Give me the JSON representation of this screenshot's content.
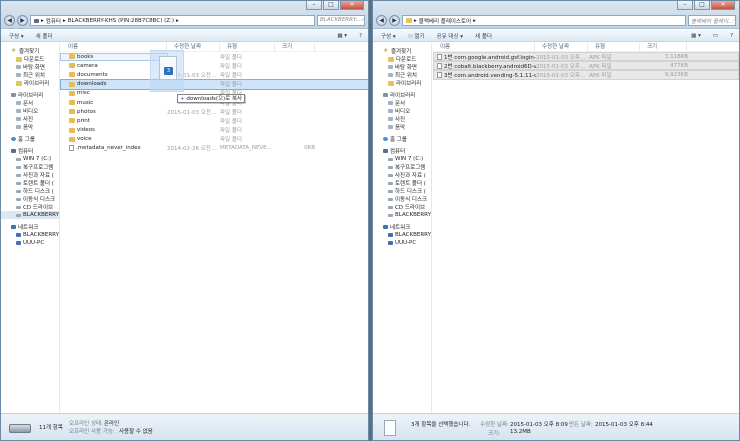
{
  "left": {
    "breadcrumb": [
      "컴퓨터",
      "BLACKBERRY-KHS (PIN:28B7C8BC) (Z:)"
    ],
    "search_placeholder": "BLACKBERRY...",
    "toolbar": {
      "organize": "구성 ▾",
      "new_folder": "새 폴더"
    },
    "columns": {
      "name": "이름",
      "date": "수정한 날짜",
      "type": "유형",
      "size": "크기"
    },
    "rows": [
      {
        "name": "books",
        "date": "",
        "type": "파일 폴더",
        "size": ""
      },
      {
        "name": "camera",
        "date": "",
        "type": "파일 폴더",
        "size": ""
      },
      {
        "name": "documents",
        "date": "2015-01-03 오전...",
        "type": "파일 폴더",
        "size": ""
      },
      {
        "name": "downloads",
        "date": "",
        "type": "파일 폴더",
        "size": ""
      },
      {
        "name": "misc",
        "date": "",
        "type": "파일 폴더",
        "size": ""
      },
      {
        "name": "music",
        "date": "",
        "type": "파일 폴더",
        "size": ""
      },
      {
        "name": "photos",
        "date": "2015-01-03 오전...",
        "type": "파일 폴더",
        "size": ""
      },
      {
        "name": "print",
        "date": "",
        "type": "파일 폴더",
        "size": ""
      },
      {
        "name": "videos",
        "date": "",
        "type": "파일 폴더",
        "size": ""
      },
      {
        "name": "voice",
        "date": "",
        "type": "파일 폴더",
        "size": ""
      },
      {
        "name": ".metadata_never_index",
        "date": "2014-02-26 오전...",
        "type": "METADATA_NEVE...",
        "size": "0KB"
      }
    ],
    "drag_tooltip": "downloads(으)로 복사",
    "status": {
      "count": "11개 항목",
      "offline_status_label": "오프라인 상태:",
      "offline_status": "온라인",
      "offline_avail_label": "오프라인 사용 가능:",
      "offline_avail": "사용할 수 없음"
    }
  },
  "right": {
    "breadcrumb": [
      "블랙베리 플레이스토어"
    ],
    "search_placeholder": "블랙베리 플레이...",
    "toolbar": {
      "organize": "구성 ▾",
      "open": "열기",
      "share": "공유 대상 ▾",
      "new_folder": "새 폴더"
    },
    "columns": {
      "name": "이름",
      "date": "수정한 날짜",
      "type": "유형",
      "size": "크기"
    },
    "rows": [
      {
        "name": "1번 com.google.android.gsf.login-4.3-c...",
        "date": "2015-01-03 오후...",
        "type": "APK 파일",
        "size": "3,118KB"
      },
      {
        "name": "2번 cobalt.blackberry.android6D-v1.3.apk",
        "date": "2015-01-03 오후...",
        "type": "APK 파일",
        "size": "477KB"
      },
      {
        "name": "3번 com.android.vending-5.1.11-cobalt...",
        "date": "2015-01-03 오후...",
        "type": "APK 파일",
        "size": "9,923KB"
      }
    ],
    "status": {
      "selected": "3개 항목을 선택했습니다.",
      "modified_label": "수정한 날짜:",
      "modified": "2015-01-03 오후 8:09",
      "created_label": "만든 날짜:",
      "created": "2015-01-03 오후 8:44",
      "size_label": "크기:",
      "size": "13.2MB"
    }
  },
  "nav": {
    "favorites": "즐겨찾기",
    "fav_items": [
      "다운로드",
      "바탕 화면",
      "최근 위치",
      "라이브러리"
    ],
    "libraries": "라이브러리",
    "lib_items": [
      "문서",
      "비디오",
      "사진",
      "음악"
    ],
    "homegroup": "홈 그룹",
    "computer": "컴퓨터",
    "comp_items": [
      "WIN 7 (C:)",
      "복구프로그램",
      "사진과 자료 (",
      "토렌트 폴더 (",
      "하드 디스크 (",
      "이동식 디스크",
      "CD 드라이브",
      "BLACKBERRY"
    ],
    "network": "네트워크",
    "net_items": [
      "BLACKBERRY",
      "UUU-PC"
    ]
  }
}
